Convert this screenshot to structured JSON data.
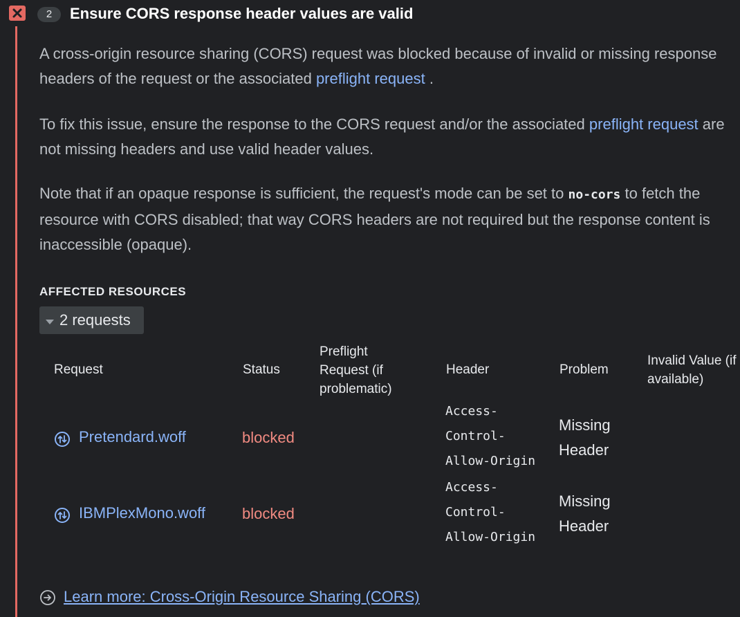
{
  "issue": {
    "count": "2",
    "title": "Ensure CORS response header values are valid",
    "icon": "error-x-icon",
    "color_accent": "#e46962"
  },
  "description": {
    "p1_text": "A cross-origin resource sharing (CORS) request was blocked because of invalid or missing response headers of the request or the associated",
    "p1_link": "preflight request",
    "p1_end": ".",
    "p2_text": "To fix this issue, ensure the response to the CORS request and/or the associated",
    "p2_link": "preflight request",
    "p2_end": "are not missing headers and use valid header values.",
    "p3_text_a": "Note that if an opaque response is sufficient, the request's mode can be set to",
    "p3_code": "no-cors",
    "p3_text_b": "to fetch the resource with CORS disabled; that way CORS headers are not required but the response content is inaccessible (opaque)."
  },
  "affected": {
    "label": "AFFECTED RESOURCES",
    "toggle_label": "2 requests",
    "columns": {
      "request": "Request",
      "status": "Status",
      "preflight": "Preflight Request (if problematic)",
      "header": "Header",
      "problem": "Problem",
      "invalid_value": "Invalid Value (if available)"
    },
    "rows": [
      {
        "request": "Pretendard.woff",
        "status": "blocked",
        "preflight": "",
        "header": "Access-Control-Allow-Origin",
        "problem": "Missing Header",
        "invalid_value": ""
      },
      {
        "request": "IBMPlexMono.woff",
        "status": "blocked",
        "preflight": "",
        "header": "Access-Control-Allow-Origin",
        "problem": "Missing Header",
        "invalid_value": ""
      }
    ]
  },
  "learn_more": {
    "label": "Learn more: Cross-Origin Resource Sharing (CORS)",
    "icon": "arrow-circle-right-icon"
  },
  "colors": {
    "background": "#202124",
    "link": "#8ab4f8",
    "blocked": "#f28b82",
    "error": "#e46962"
  }
}
